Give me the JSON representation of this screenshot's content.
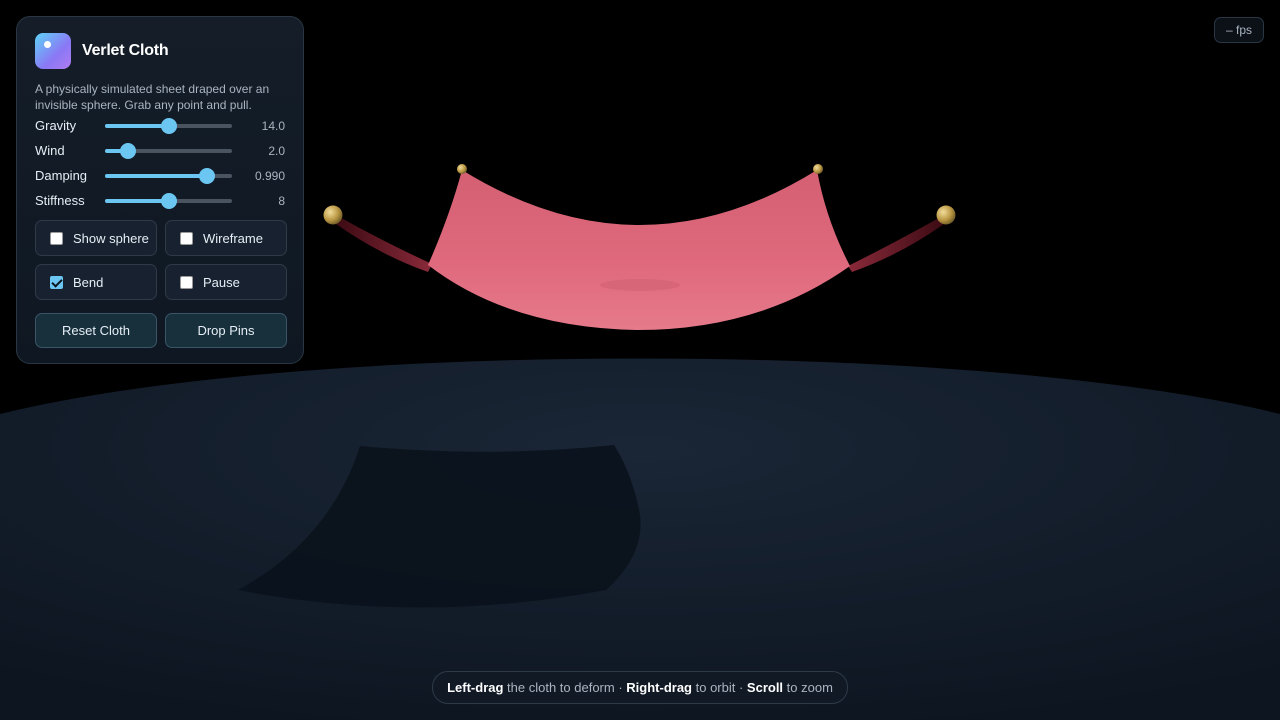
{
  "app": {
    "title": "Verlet Cloth",
    "description": "A physically simulated sheet draped over an invisible sphere. Grab any point and pull."
  },
  "sliders": [
    {
      "label": "Gravity",
      "value": "14.0",
      "fraction": 0.5
    },
    {
      "label": "Wind",
      "value": "2.0",
      "fraction": 0.18
    },
    {
      "label": "Damping",
      "value": "0.990",
      "fraction": 0.8
    },
    {
      "label": "Stiffness",
      "value": "8",
      "fraction": 0.5
    }
  ],
  "toggles": [
    {
      "label": "Show sphere",
      "checked": false
    },
    {
      "label": "Wireframe",
      "checked": false
    },
    {
      "label": "Bend",
      "checked": true
    },
    {
      "label": "Pause",
      "checked": false
    }
  ],
  "buttons": {
    "reset": "Reset Cloth",
    "drop_pins": "Drop Pins"
  },
  "fps": {
    "text": "– fps"
  },
  "hint": {
    "drag_key": "Left-drag",
    "drag_text": " the cloth to deform · ",
    "orbit_key": "Right-drag",
    "orbit_text": " to orbit · ",
    "zoom_key": "Scroll",
    "zoom_text": " to zoom"
  },
  "colors": {
    "accent": "#6cc6f2",
    "cloth": "#e06a7d",
    "pin": "#c9a852",
    "floor": "#152030"
  },
  "icons": {
    "app": "app-logo-icon"
  }
}
